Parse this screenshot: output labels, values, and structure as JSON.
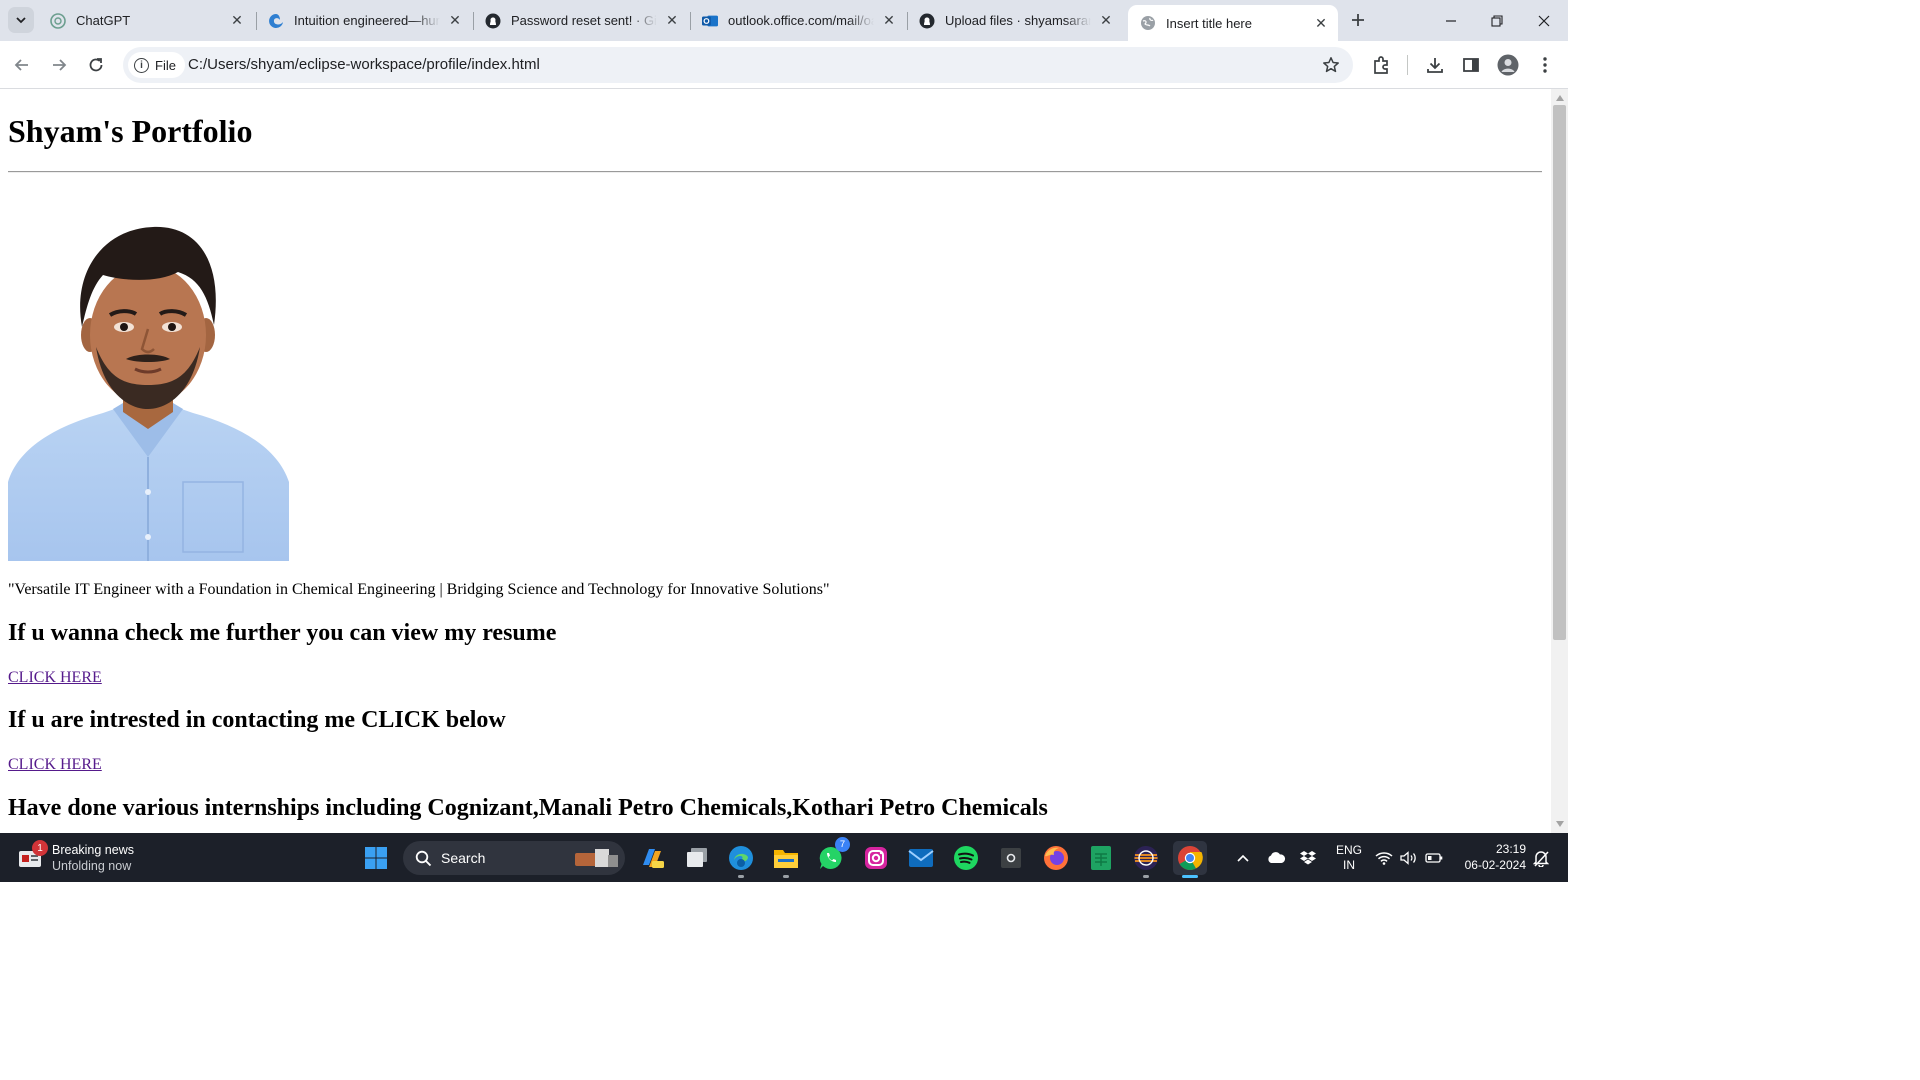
{
  "browser": {
    "tabs": [
      {
        "title": "ChatGPT",
        "icon": "chatgpt-icon",
        "active": false
      },
      {
        "title": "Intuition engineered—hum",
        "icon": "edge-icon",
        "active": false
      },
      {
        "title": "Password reset sent! · GitH",
        "icon": "github-icon",
        "active": false
      },
      {
        "title": "outlook.office.com/mail/oa",
        "icon": "outlook-icon",
        "active": false
      },
      {
        "title": "Upload files · shyamsaranr",
        "icon": "github-icon",
        "active": false
      },
      {
        "title": "Insert title here",
        "icon": "globe-icon",
        "active": true
      }
    ],
    "address": {
      "chip_label": "File",
      "url": "C:/Users/shyam/eclipse-workspace/profile/index.html"
    }
  },
  "page": {
    "title": "Shyam's Portfolio",
    "photo_alt": "Profile photo",
    "tagline": "\"Versatile IT Engineer with a Foundation in Chemical Engineering | Bridging Science and Technology for Innovative Solutions\"",
    "resume_heading": "If u wanna check me further you can view my resume",
    "resume_link": "CLICK HERE",
    "contact_heading": "If u are intrested in contacting me CLICK below",
    "contact_link": "CLICK HERE",
    "internships_heading": "Have done various internships including Cognizant,Manali Petro Chemicals,Kothari Petro Chemicals"
  },
  "taskbar": {
    "news_title": "Breaking news",
    "news_subtitle": "Unfolding now",
    "news_badge": "1",
    "search_placeholder": "Search",
    "whatsapp_badge": "7",
    "language_line1": "ENG",
    "language_line2": "IN",
    "time": "23:19",
    "date": "06-02-2024"
  },
  "colors": {
    "tabstrip_bg": "#dfe3eb",
    "link_visited": "#551a8b",
    "taskbar_bg": "#1c2029",
    "accent_blue": "#4cc2ff"
  }
}
